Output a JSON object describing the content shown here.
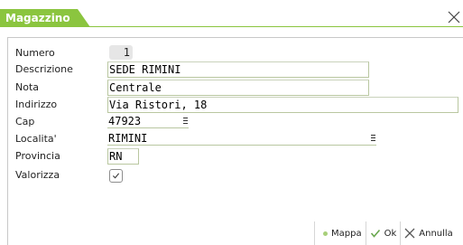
{
  "window": {
    "title": "Magazzino"
  },
  "form": {
    "numero": {
      "label": "Numero",
      "value": "1"
    },
    "descrizione": {
      "label": "Descrizione",
      "value": "SEDE RIMINI"
    },
    "nota": {
      "label": "Nota",
      "value": "Centrale"
    },
    "indirizzo": {
      "label": "Indirizzo",
      "value": "Via Ristori, 18"
    },
    "cap": {
      "label": "Cap",
      "value": "47923"
    },
    "localita": {
      "label": "Localita'",
      "value": "RIMINI"
    },
    "provincia": {
      "label": "Provincia",
      "value": "RN"
    },
    "valorizza": {
      "label": "Valorizza",
      "checked": true
    }
  },
  "footer": {
    "mappa": "Mappa",
    "ok": "Ok",
    "annulla": "Annulla"
  },
  "icons": {
    "close": "close-icon",
    "check": "check-icon",
    "menu": "menu-lines-icon",
    "dot": "dot-icon"
  },
  "colors": {
    "accent": "#8bc53f",
    "ok_check": "#6aa84f"
  }
}
